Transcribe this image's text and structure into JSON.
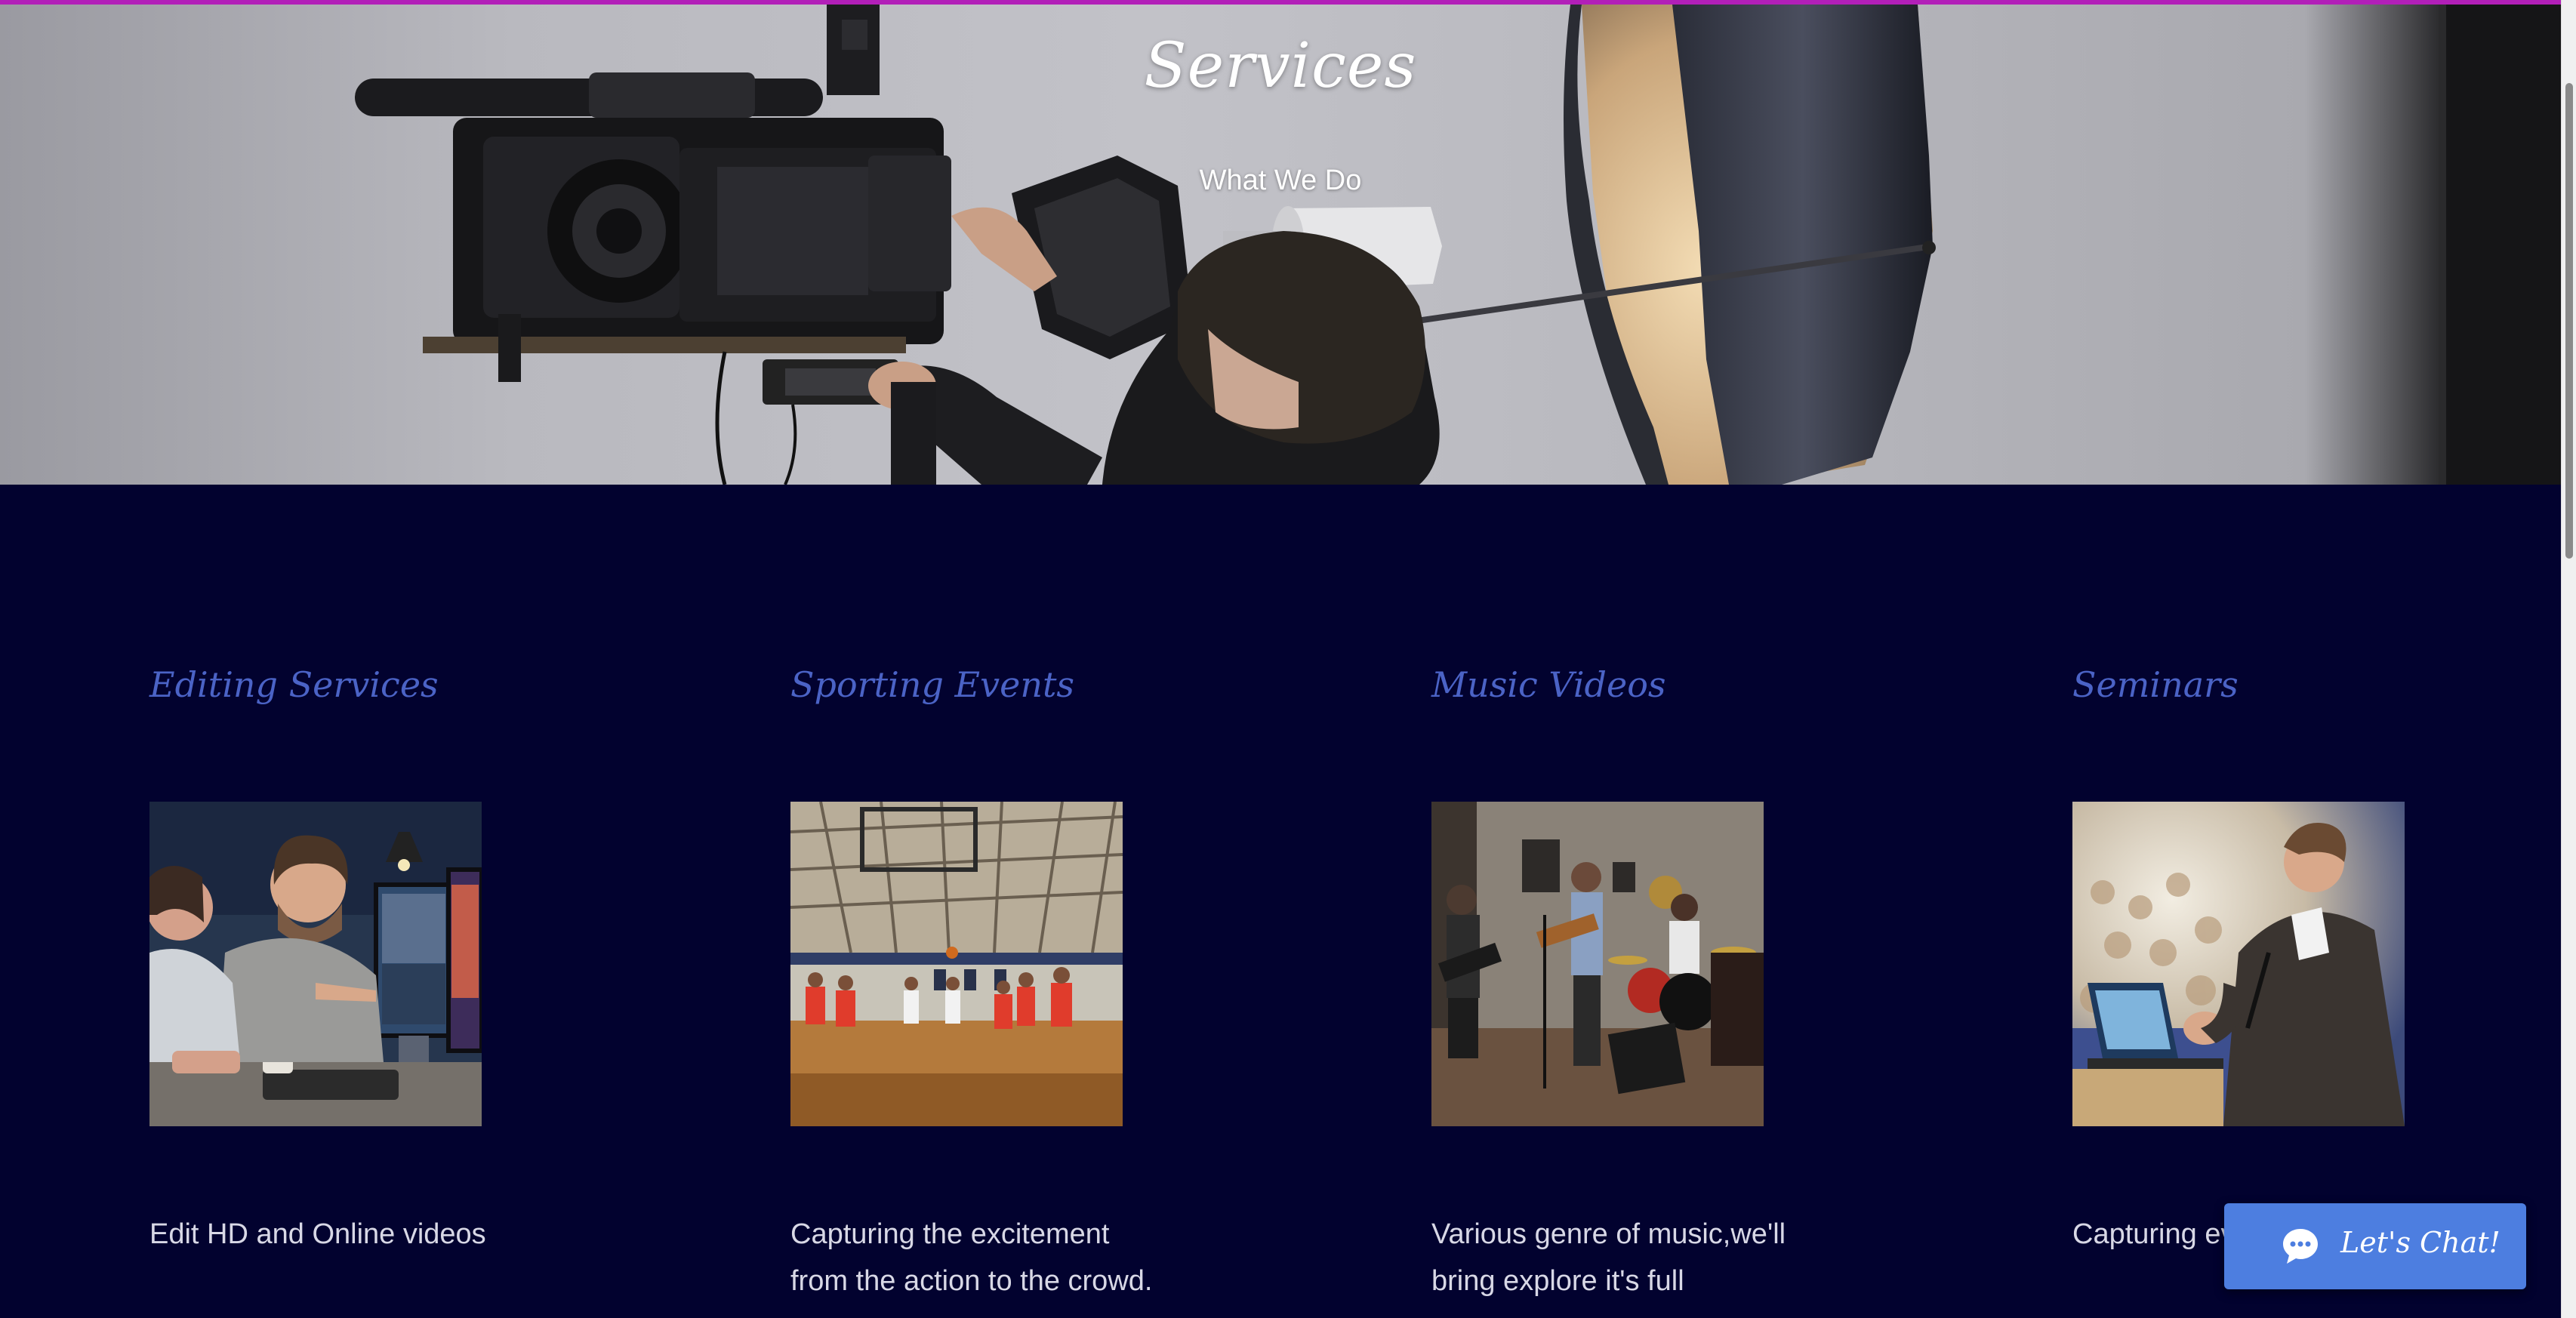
{
  "hero": {
    "title": "Services",
    "subtitle": "What We Do"
  },
  "services": [
    {
      "title": "Editing Services",
      "description": "Edit HD and Online videos",
      "image": "video-editing-team-photo"
    },
    {
      "title": "Sporting Events",
      "description": "Capturing the excitement from the action to the crowd.",
      "image": "basketball-game-photo"
    },
    {
      "title": "Music Videos",
      "description": "Various genre of music,we'll bring explore it's full",
      "image": "band-rehearsal-photo"
    },
    {
      "title": "Seminars",
      "description": "Capturing every knowledge.",
      "image": "seminar-speaker-photo"
    }
  ],
  "chat": {
    "label": "Let's Chat!",
    "icon": "chat-bubble-icon"
  },
  "colors": {
    "background": "#02022f",
    "accent_bar": "#b21fb8",
    "service_title": "#4b63c6",
    "chat_button": "#4d7ee0"
  }
}
